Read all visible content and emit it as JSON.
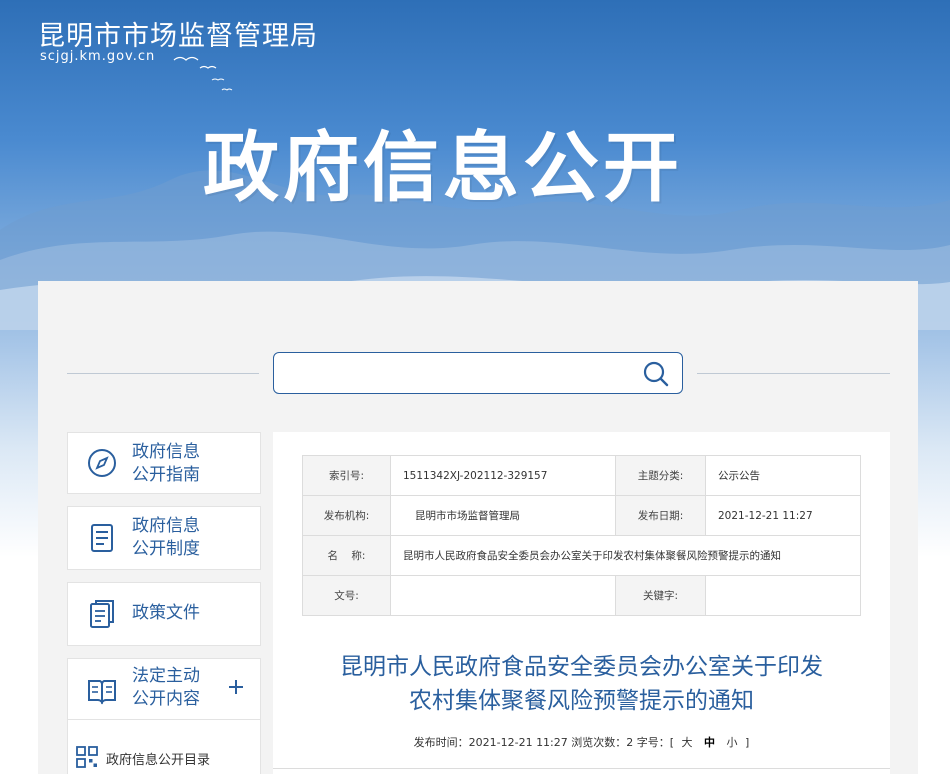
{
  "site": {
    "name": "昆明市市场监督管理局",
    "domain": "scjgj.km.gov.cn",
    "hero_title": "政府信息公开"
  },
  "search": {
    "placeholder": "",
    "icon": "search-icon"
  },
  "sidebar": {
    "items": [
      {
        "line1": "政府信息",
        "line2": "公开指南",
        "icon": "compass-icon"
      },
      {
        "line1": "政府信息",
        "line2": "公开制度",
        "icon": "document-list-icon"
      },
      {
        "line1": "政策文件",
        "icon": "policy-files-icon"
      },
      {
        "line1": "法定主动",
        "line2": "公开内容",
        "icon": "open-book-icon",
        "expand": "+"
      }
    ],
    "sub_items": [
      {
        "label": "政府信息公开目录",
        "icon": "grid-icon"
      }
    ]
  },
  "meta_table": {
    "index_label": "索引号:",
    "index_value": "1511342XJ-202112-329157",
    "category_label": "主题分类:",
    "category_value": "公示公告",
    "publisher_label": "发布机构:",
    "publisher_value": "昆明市市场监督管理局",
    "date_label": "发布日期:",
    "date_value": "2021-12-21 11:27",
    "name_label": "名    称:",
    "name_value": "昆明市人民政府食品安全委员会办公室关于印发农村集体聚餐风险预警提示的通知",
    "doc_no_label": "文号:",
    "doc_no_value": "",
    "keywords_label": "关键字:",
    "keywords_value": ""
  },
  "article": {
    "title_line1": "昆明市人民政府食品安全委员会办公室关于印发",
    "title_line2": "农村集体聚餐风险预警提示的通知",
    "meta_prefix": "发布时间：2021-12-21 11:27 浏览次数：2 字号：[",
    "font_large": "大",
    "font_medium": "中",
    "font_small": "小",
    "meta_suffix": "]"
  },
  "colors": {
    "brand_blue": "#2a5f9e",
    "banner_top": "#2e6fb7",
    "panel_bg": "#f3f3f3"
  }
}
